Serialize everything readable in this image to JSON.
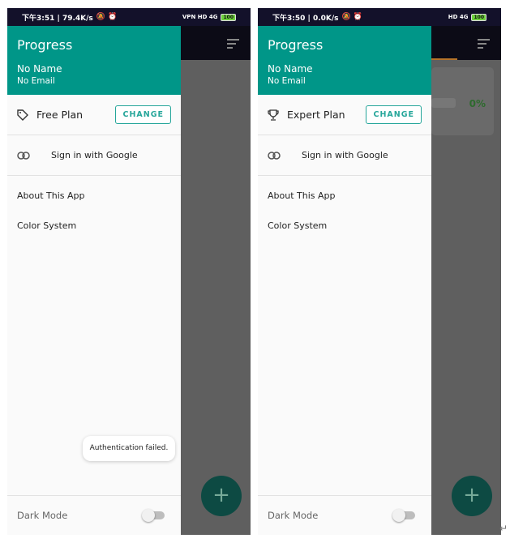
{
  "phones": [
    {
      "status_time": "下午3:51 | 79.4K/s",
      "status_icons": "VPN HD 4G",
      "battery": "100",
      "drawer": {
        "title": "Progress",
        "name": "No Name",
        "email": "No Email",
        "plan_icon": "tag-icon",
        "plan": "Free Plan",
        "change": "CHANGE",
        "sign_in": "Sign in with Google",
        "menu": [
          "About This App",
          "Color System"
        ],
        "dark_mode": "Dark Mode",
        "dark_mode_on": false
      },
      "toast": "Authentication failed.",
      "fab": "+"
    },
    {
      "status_time": "下午3:50 | 0.0K/s",
      "status_icons": "HD 4G",
      "battery": "100",
      "drawer": {
        "title": "Progress",
        "name": "No Name",
        "email": "No Email",
        "plan_icon": "trophy-icon",
        "plan": "Expert Plan",
        "change": "CHANGE",
        "sign_in": "Sign in with Google",
        "menu": [
          "About This App",
          "Color System"
        ],
        "dark_mode": "Dark Mode",
        "dark_mode_on": false
      },
      "card_percent": "0%",
      "fab": "+"
    }
  ],
  "corner_mark": "↵",
  "colors": {
    "primary": "#009688",
    "accent": "#26a69a"
  }
}
